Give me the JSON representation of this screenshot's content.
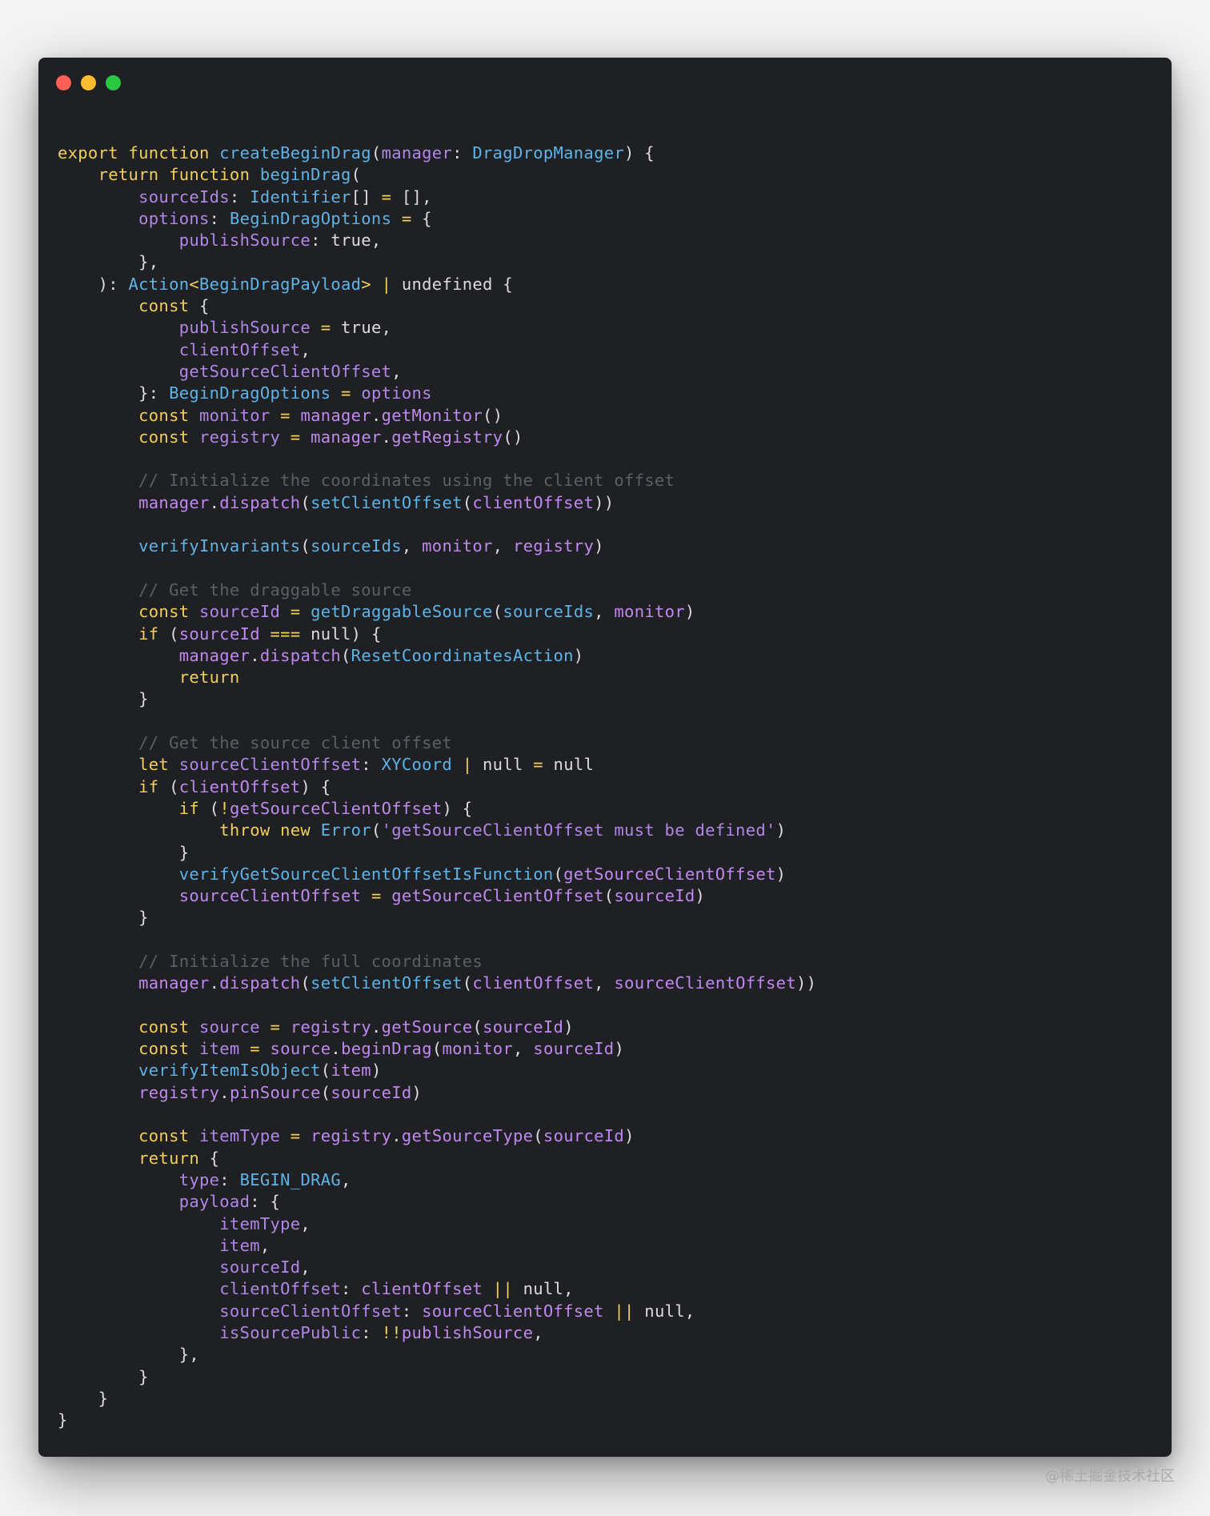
{
  "window": {
    "controls": [
      {
        "name": "close",
        "color": "#ff5f57"
      },
      {
        "name": "minimize",
        "color": "#febc2e"
      },
      {
        "name": "maximize",
        "color": "#28c840"
      }
    ]
  },
  "theme": {
    "kw": "#f2cf5b",
    "fn": "#5fb3e6",
    "ty": "#5fb3e6",
    "var": "#b187e8",
    "id": "#c089ef",
    "plain": "#dcdcdc",
    "op": "#f2cf5b",
    "cm": "#5b5f66",
    "str": "#b187e8",
    "lit": "#dcdcdc"
  },
  "code": [
    [
      [
        "kw",
        "export function "
      ],
      [
        "fn",
        "createBeginDrag"
      ],
      [
        "plain",
        "("
      ],
      [
        "var",
        "manager"
      ],
      [
        "plain",
        ": "
      ],
      [
        "ty",
        "DragDropManager"
      ],
      [
        "plain",
        ") {"
      ]
    ],
    [
      [
        "plain",
        "    "
      ],
      [
        "kw",
        "return function "
      ],
      [
        "fn",
        "beginDrag"
      ],
      [
        "plain",
        "("
      ]
    ],
    [
      [
        "plain",
        "        "
      ],
      [
        "var",
        "sourceIds"
      ],
      [
        "plain",
        ": "
      ],
      [
        "ty",
        "Identifier"
      ],
      [
        "plain",
        "[] "
      ],
      [
        "op",
        "="
      ],
      [
        "plain",
        " [],"
      ]
    ],
    [
      [
        "plain",
        "        "
      ],
      [
        "var",
        "options"
      ],
      [
        "plain",
        ": "
      ],
      [
        "ty",
        "BeginDragOptions"
      ],
      [
        "plain",
        " "
      ],
      [
        "op",
        "="
      ],
      [
        "plain",
        " {"
      ]
    ],
    [
      [
        "plain",
        "            "
      ],
      [
        "var",
        "publishSource"
      ],
      [
        "plain",
        ": true,"
      ]
    ],
    [
      [
        "plain",
        "        },"
      ]
    ],
    [
      [
        "plain",
        "    ): "
      ],
      [
        "ty",
        "Action"
      ],
      [
        "op",
        "<"
      ],
      [
        "ty",
        "BeginDragPayload"
      ],
      [
        "op",
        "> | "
      ],
      [
        "plain",
        "undefined {"
      ]
    ],
    [
      [
        "plain",
        "        "
      ],
      [
        "kw",
        "const"
      ],
      [
        "plain",
        " {"
      ]
    ],
    [
      [
        "plain",
        "            "
      ],
      [
        "var",
        "publishSource"
      ],
      [
        "plain",
        " "
      ],
      [
        "op",
        "="
      ],
      [
        "plain",
        " true,"
      ]
    ],
    [
      [
        "plain",
        "            "
      ],
      [
        "var",
        "clientOffset"
      ],
      [
        "plain",
        ","
      ]
    ],
    [
      [
        "plain",
        "            "
      ],
      [
        "var",
        "getSourceClientOffset"
      ],
      [
        "plain",
        ","
      ]
    ],
    [
      [
        "plain",
        "        }: "
      ],
      [
        "ty",
        "BeginDragOptions"
      ],
      [
        "plain",
        " "
      ],
      [
        "op",
        "="
      ],
      [
        "plain",
        " "
      ],
      [
        "var",
        "options"
      ]
    ],
    [
      [
        "plain",
        "        "
      ],
      [
        "kw",
        "const "
      ],
      [
        "var",
        "monitor"
      ],
      [
        "plain",
        " "
      ],
      [
        "op",
        "="
      ],
      [
        "plain",
        " "
      ],
      [
        "id",
        "manager"
      ],
      [
        "plain",
        "."
      ],
      [
        "id",
        "getMonitor"
      ],
      [
        "plain",
        "()"
      ]
    ],
    [
      [
        "plain",
        "        "
      ],
      [
        "kw",
        "const "
      ],
      [
        "var",
        "registry"
      ],
      [
        "plain",
        " "
      ],
      [
        "op",
        "="
      ],
      [
        "plain",
        " "
      ],
      [
        "id",
        "manager"
      ],
      [
        "plain",
        "."
      ],
      [
        "id",
        "getRegistry"
      ],
      [
        "plain",
        "()"
      ]
    ],
    [],
    [
      [
        "plain",
        "        "
      ],
      [
        "cm",
        "// Initialize the coordinates using the client offset"
      ]
    ],
    [
      [
        "plain",
        "        "
      ],
      [
        "id",
        "manager"
      ],
      [
        "plain",
        "."
      ],
      [
        "id",
        "dispatch"
      ],
      [
        "plain",
        "("
      ],
      [
        "fn",
        "setClientOffset"
      ],
      [
        "plain",
        "("
      ],
      [
        "id",
        "clientOffset"
      ],
      [
        "plain",
        "))"
      ]
    ],
    [],
    [
      [
        "plain",
        "        "
      ],
      [
        "fn",
        "verifyInvariants"
      ],
      [
        "plain",
        "("
      ],
      [
        "fn",
        "sourceIds"
      ],
      [
        "plain",
        ", "
      ],
      [
        "id",
        "monitor"
      ],
      [
        "plain",
        ", "
      ],
      [
        "id",
        "registry"
      ],
      [
        "plain",
        ")"
      ]
    ],
    [],
    [
      [
        "plain",
        "        "
      ],
      [
        "cm",
        "// Get the draggable source"
      ]
    ],
    [
      [
        "plain",
        "        "
      ],
      [
        "kw",
        "const "
      ],
      [
        "var",
        "sourceId"
      ],
      [
        "plain",
        " "
      ],
      [
        "op",
        "="
      ],
      [
        "plain",
        " "
      ],
      [
        "fn",
        "getDraggableSource"
      ],
      [
        "plain",
        "("
      ],
      [
        "fn",
        "sourceIds"
      ],
      [
        "plain",
        ", "
      ],
      [
        "id",
        "monitor"
      ],
      [
        "plain",
        ")"
      ]
    ],
    [
      [
        "plain",
        "        "
      ],
      [
        "kw",
        "if"
      ],
      [
        "plain",
        " ("
      ],
      [
        "id",
        "sourceId"
      ],
      [
        "plain",
        " "
      ],
      [
        "op",
        "==="
      ],
      [
        "plain",
        " null) {"
      ]
    ],
    [
      [
        "plain",
        "            "
      ],
      [
        "id",
        "manager"
      ],
      [
        "plain",
        "."
      ],
      [
        "id",
        "dispatch"
      ],
      [
        "plain",
        "("
      ],
      [
        "fn",
        "ResetCoordinatesAction"
      ],
      [
        "plain",
        ")"
      ]
    ],
    [
      [
        "plain",
        "            "
      ],
      [
        "kw",
        "return"
      ]
    ],
    [
      [
        "plain",
        "        }"
      ]
    ],
    [],
    [
      [
        "plain",
        "        "
      ],
      [
        "cm",
        "// Get the source client offset"
      ]
    ],
    [
      [
        "plain",
        "        "
      ],
      [
        "kw",
        "let "
      ],
      [
        "var",
        "sourceClientOffset"
      ],
      [
        "plain",
        ": "
      ],
      [
        "ty",
        "XYCoord"
      ],
      [
        "plain",
        " "
      ],
      [
        "op",
        "|"
      ],
      [
        "plain",
        " null "
      ],
      [
        "op",
        "="
      ],
      [
        "plain",
        " null"
      ]
    ],
    [
      [
        "plain",
        "        "
      ],
      [
        "kw",
        "if"
      ],
      [
        "plain",
        " ("
      ],
      [
        "id",
        "clientOffset"
      ],
      [
        "plain",
        ") {"
      ]
    ],
    [
      [
        "plain",
        "            "
      ],
      [
        "kw",
        "if"
      ],
      [
        "plain",
        " ("
      ],
      [
        "op",
        "!"
      ],
      [
        "id",
        "getSourceClientOffset"
      ],
      [
        "plain",
        ") {"
      ]
    ],
    [
      [
        "plain",
        "                "
      ],
      [
        "kw",
        "throw new "
      ],
      [
        "fn",
        "Error"
      ],
      [
        "plain",
        "("
      ],
      [
        "str",
        "'getSourceClientOffset must be defined'"
      ],
      [
        "plain",
        ")"
      ]
    ],
    [
      [
        "plain",
        "            }"
      ]
    ],
    [
      [
        "plain",
        "            "
      ],
      [
        "fn",
        "verifyGetSourceClientOffsetIsFunction"
      ],
      [
        "plain",
        "("
      ],
      [
        "id",
        "getSourceClientOffset"
      ],
      [
        "plain",
        ")"
      ]
    ],
    [
      [
        "plain",
        "            "
      ],
      [
        "id",
        "sourceClientOffset"
      ],
      [
        "plain",
        " "
      ],
      [
        "op",
        "="
      ],
      [
        "plain",
        " "
      ],
      [
        "id",
        "getSourceClientOffset"
      ],
      [
        "plain",
        "("
      ],
      [
        "id",
        "sourceId"
      ],
      [
        "plain",
        ")"
      ]
    ],
    [
      [
        "plain",
        "        }"
      ]
    ],
    [],
    [
      [
        "plain",
        "        "
      ],
      [
        "cm",
        "// Initialize the full coordinates"
      ]
    ],
    [
      [
        "plain",
        "        "
      ],
      [
        "id",
        "manager"
      ],
      [
        "plain",
        "."
      ],
      [
        "id",
        "dispatch"
      ],
      [
        "plain",
        "("
      ],
      [
        "fn",
        "setClientOffset"
      ],
      [
        "plain",
        "("
      ],
      [
        "id",
        "clientOffset"
      ],
      [
        "plain",
        ", "
      ],
      [
        "id",
        "sourceClientOffset"
      ],
      [
        "plain",
        "))"
      ]
    ],
    [],
    [
      [
        "plain",
        "        "
      ],
      [
        "kw",
        "const "
      ],
      [
        "var",
        "source"
      ],
      [
        "plain",
        " "
      ],
      [
        "op",
        "="
      ],
      [
        "plain",
        " "
      ],
      [
        "id",
        "registry"
      ],
      [
        "plain",
        "."
      ],
      [
        "id",
        "getSource"
      ],
      [
        "plain",
        "("
      ],
      [
        "id",
        "sourceId"
      ],
      [
        "plain",
        ")"
      ]
    ],
    [
      [
        "plain",
        "        "
      ],
      [
        "kw",
        "const "
      ],
      [
        "var",
        "item"
      ],
      [
        "plain",
        " "
      ],
      [
        "op",
        "="
      ],
      [
        "plain",
        " "
      ],
      [
        "id",
        "source"
      ],
      [
        "plain",
        "."
      ],
      [
        "id",
        "beginDrag"
      ],
      [
        "plain",
        "("
      ],
      [
        "id",
        "monitor"
      ],
      [
        "plain",
        ", "
      ],
      [
        "id",
        "sourceId"
      ],
      [
        "plain",
        ")"
      ]
    ],
    [
      [
        "plain",
        "        "
      ],
      [
        "fn",
        "verifyItemIsObject"
      ],
      [
        "plain",
        "("
      ],
      [
        "id",
        "item"
      ],
      [
        "plain",
        ")"
      ]
    ],
    [
      [
        "plain",
        "        "
      ],
      [
        "id",
        "registry"
      ],
      [
        "plain",
        "."
      ],
      [
        "id",
        "pinSource"
      ],
      [
        "plain",
        "("
      ],
      [
        "id",
        "sourceId"
      ],
      [
        "plain",
        ")"
      ]
    ],
    [],
    [
      [
        "plain",
        "        "
      ],
      [
        "kw",
        "const "
      ],
      [
        "var",
        "itemType"
      ],
      [
        "plain",
        " "
      ],
      [
        "op",
        "="
      ],
      [
        "plain",
        " "
      ],
      [
        "id",
        "registry"
      ],
      [
        "plain",
        "."
      ],
      [
        "id",
        "getSourceType"
      ],
      [
        "plain",
        "("
      ],
      [
        "id",
        "sourceId"
      ],
      [
        "plain",
        ")"
      ]
    ],
    [
      [
        "plain",
        "        "
      ],
      [
        "kw",
        "return"
      ],
      [
        "plain",
        " {"
      ]
    ],
    [
      [
        "plain",
        "            "
      ],
      [
        "var",
        "type"
      ],
      [
        "plain",
        ": "
      ],
      [
        "fn",
        "BEGIN_DRAG"
      ],
      [
        "plain",
        ","
      ]
    ],
    [
      [
        "plain",
        "            "
      ],
      [
        "var",
        "payload"
      ],
      [
        "plain",
        ": {"
      ]
    ],
    [
      [
        "plain",
        "                "
      ],
      [
        "var",
        "itemType"
      ],
      [
        "plain",
        ","
      ]
    ],
    [
      [
        "plain",
        "                "
      ],
      [
        "var",
        "item"
      ],
      [
        "plain",
        ","
      ]
    ],
    [
      [
        "plain",
        "                "
      ],
      [
        "var",
        "sourceId"
      ],
      [
        "plain",
        ","
      ]
    ],
    [
      [
        "plain",
        "                "
      ],
      [
        "var",
        "clientOffset"
      ],
      [
        "plain",
        ": "
      ],
      [
        "id",
        "clientOffset"
      ],
      [
        "plain",
        " "
      ],
      [
        "op",
        "||"
      ],
      [
        "plain",
        " null,"
      ]
    ],
    [
      [
        "plain",
        "                "
      ],
      [
        "var",
        "sourceClientOffset"
      ],
      [
        "plain",
        ": "
      ],
      [
        "id",
        "sourceClientOffset"
      ],
      [
        "plain",
        " "
      ],
      [
        "op",
        "||"
      ],
      [
        "plain",
        " null,"
      ]
    ],
    [
      [
        "plain",
        "                "
      ],
      [
        "var",
        "isSourcePublic"
      ],
      [
        "plain",
        ": "
      ],
      [
        "op",
        "!!"
      ],
      [
        "id",
        "publishSource"
      ],
      [
        "plain",
        ","
      ]
    ],
    [
      [
        "plain",
        "            },"
      ]
    ],
    [
      [
        "plain",
        "        }"
      ]
    ],
    [
      [
        "plain",
        "    }"
      ]
    ],
    [
      [
        "plain",
        "}"
      ]
    ]
  ],
  "watermark": "@稀土掘金技术社区"
}
